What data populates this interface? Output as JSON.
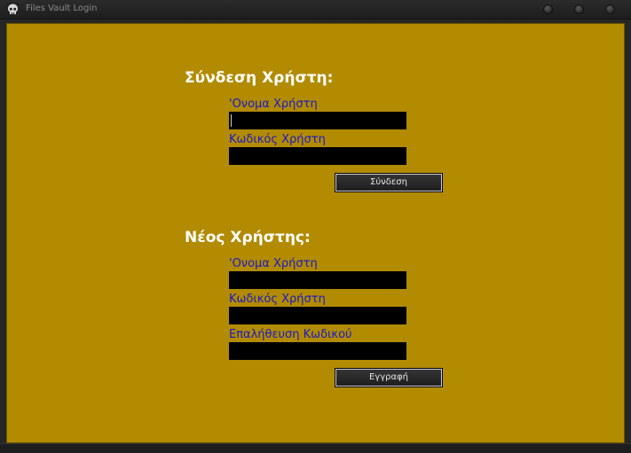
{
  "window": {
    "title": "Files Vault Login",
    "icon": "skull-icon"
  },
  "colors": {
    "background": "#b28b00",
    "heading": "#ffffff",
    "label": "#1a1ac8",
    "field": "#000000"
  },
  "login": {
    "heading": "Σύνδεση Χρήστη:",
    "username_label": "'Ονομα Χρήστη",
    "username_value": "",
    "password_label": "Κωδικός Χρήστη",
    "password_value": "",
    "button": "Σύνδεση"
  },
  "register": {
    "heading": "Νέος Χρήστης:",
    "username_label": "'Ονομα Χρήστη",
    "username_value": "",
    "password_label": "Κωδικός Χρήστη",
    "password_value": "",
    "confirm_label": "Επαλήθευση Κωδικού",
    "confirm_value": "",
    "button": "Εγγραφή"
  }
}
